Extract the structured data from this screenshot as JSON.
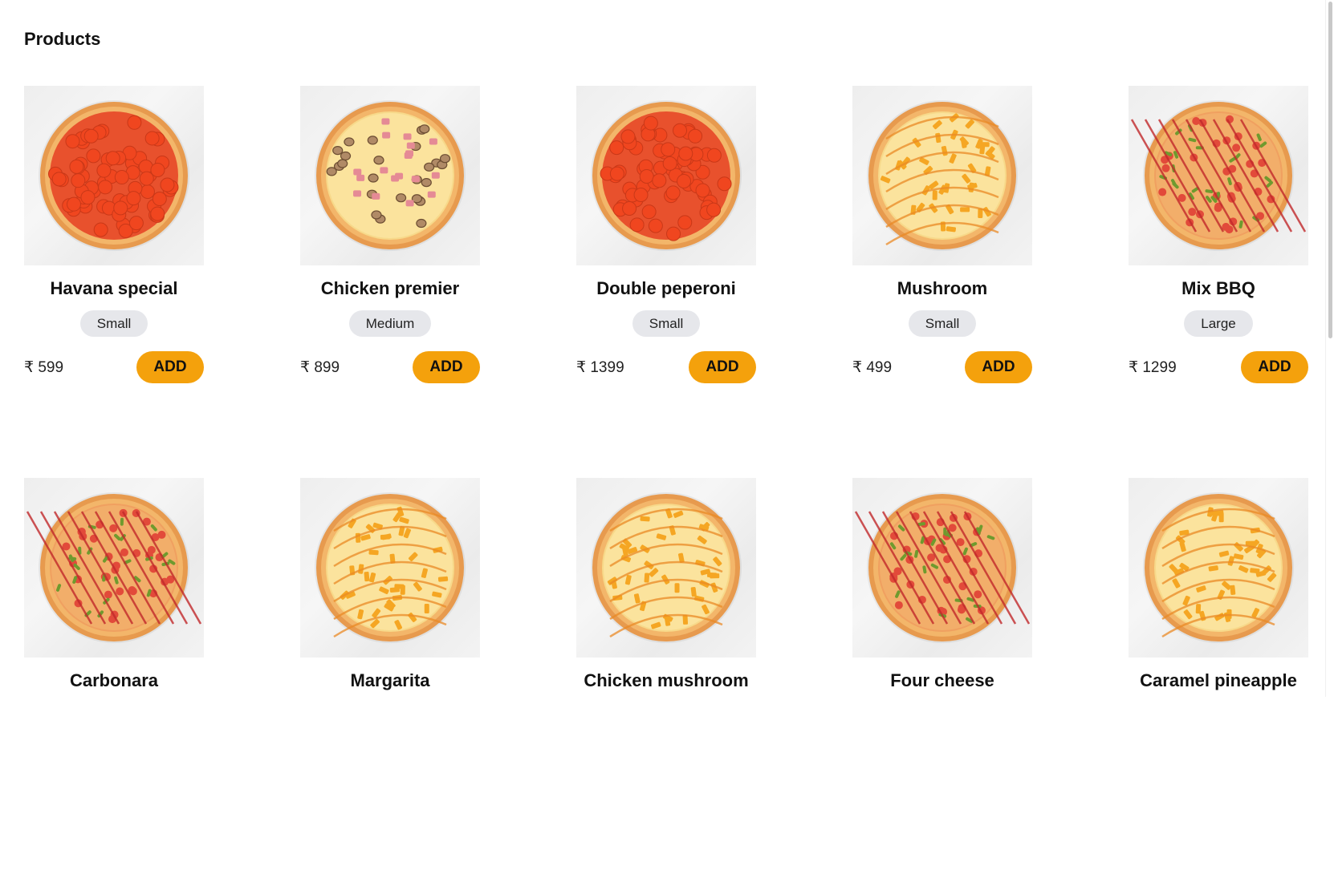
{
  "page": {
    "title": "Products"
  },
  "colors": {
    "accent": "#f4a10c",
    "size_pill": "#e6e7eb",
    "image_bg": "#efefef"
  },
  "products": [
    {
      "name": "Havana special",
      "size": "Small",
      "price": "₹ 599",
      "add_label": "ADD",
      "topping": "pepperoni"
    },
    {
      "name": "Chicken premier",
      "size": "Medium",
      "price": "₹ 899",
      "add_label": "ADD",
      "topping": "mushroom-ham"
    },
    {
      "name": "Double peperoni",
      "size": "Small",
      "price": "₹ 1399",
      "add_label": "ADD",
      "topping": "pepperoni"
    },
    {
      "name": "Mushroom",
      "size": "Small",
      "price": "₹ 499",
      "add_label": "ADD",
      "topping": "pineapple"
    },
    {
      "name": "Mix BBQ",
      "size": "Large",
      "price": "₹ 1299",
      "add_label": "ADD",
      "topping": "bbq"
    },
    {
      "name": "Carbonara",
      "topping": "bbq"
    },
    {
      "name": "Margarita",
      "topping": "pineapple"
    },
    {
      "name": "Chicken mushroom",
      "topping": "pineapple"
    },
    {
      "name": "Four cheese",
      "topping": "bbq"
    },
    {
      "name": "Caramel pineapple",
      "topping": "pineapple"
    }
  ]
}
